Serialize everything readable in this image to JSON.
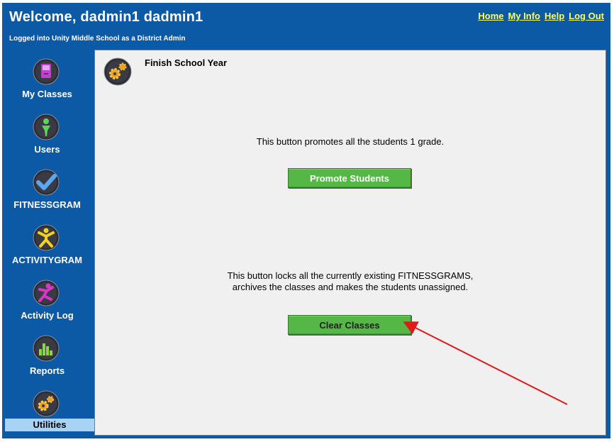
{
  "header": {
    "title": "Welcome, dadmin1 dadmin1",
    "subtitle": "Logged into Unity Middle School as a District Admin",
    "links": [
      "Home",
      "My Info",
      "Help",
      "Log Out"
    ]
  },
  "sidebar": {
    "items": [
      {
        "label": "My Classes",
        "icon": "my-classes-icon"
      },
      {
        "label": "Users",
        "icon": "users-icon"
      },
      {
        "label": "FITNESSGRAM",
        "icon": "fitnessgram-icon"
      },
      {
        "label": "ACTIVITYGRAM",
        "icon": "activitygram-icon"
      },
      {
        "label": "Activity Log",
        "icon": "activity-log-icon"
      },
      {
        "label": "Reports",
        "icon": "reports-icon"
      },
      {
        "label": "Utilities",
        "icon": "utilities-icon"
      }
    ],
    "active": "Utilities"
  },
  "main": {
    "title": "Finish School Year",
    "promote_desc": "This button promotes all the students 1 grade.",
    "promote_button": "Promote Students",
    "clear_desc_1": "This button locks all the currently existing FITNESSGRAMS,",
    "clear_desc_2": "archives the classes and makes the students unassigned.",
    "clear_button": "Clear Classes"
  },
  "colors": {
    "frame": "#0c5aa6",
    "link": "#ffff66",
    "button_green": "#55b846",
    "active_nav": "#a9d3f5",
    "annotation_arrow": "#e01a1a"
  }
}
